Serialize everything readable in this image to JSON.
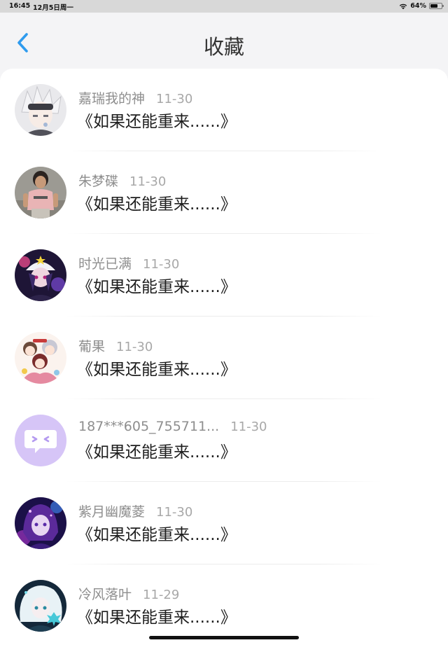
{
  "status_bar": {
    "time": "16:45",
    "date": "12月5日周一",
    "battery": "64%",
    "battery_level": 0.64
  },
  "nav": {
    "title": "收藏",
    "accent_color": "#2f9bee"
  },
  "favorites": [
    {
      "name": "嘉瑞我的神",
      "date": "11-30",
      "title": "《如果还能重来......》",
      "avatar": "anime-white-hair"
    },
    {
      "name": "朱梦碟",
      "date": "11-30",
      "title": "《如果还能重来......》",
      "avatar": "photo-girl-pink-shirt"
    },
    {
      "name": "时光已满",
      "date": "11-30",
      "title": "《如果还能重来......》",
      "avatar": "anime-purple-hat"
    },
    {
      "name": "葡果",
      "date": "11-30",
      "title": "《如果还能重来......》",
      "avatar": "anime-group-chibi"
    },
    {
      "name": "187***605_755711...",
      "date": "11-30",
      "title": "《如果还能重来......》",
      "avatar": "default-chat-bubble"
    },
    {
      "name": "紫月幽魔菱",
      "date": "11-30",
      "title": "《如果还能重来......》",
      "avatar": "anime-purple-night"
    },
    {
      "name": "冷风落叶",
      "date": "11-29",
      "title": "《如果还能重来......》",
      "avatar": "anime-white-hair-teal"
    }
  ]
}
